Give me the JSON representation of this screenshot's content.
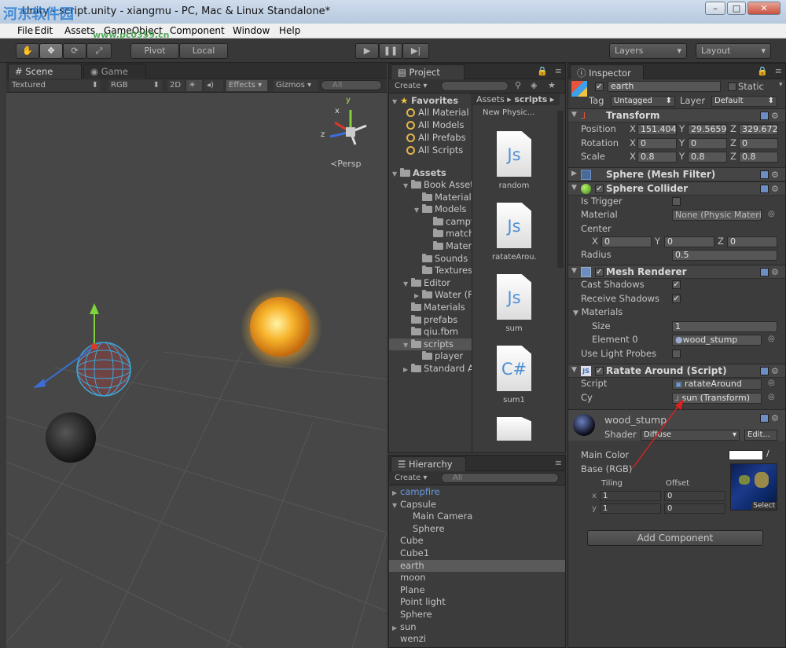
{
  "window": {
    "title": "Unity - script.unity - xiangmu - PC, Mac & Linux Standalone*",
    "watermark": "河东软件园",
    "watermark_url": "www.pc0359.cn"
  },
  "menu": [
    "File",
    "Edit",
    "Assets",
    "GameObject",
    "Component",
    "Window",
    "Help"
  ],
  "toolbar": {
    "pivot": "Pivot",
    "local": "Local",
    "layers": "Layers",
    "layout": "Layout"
  },
  "scene": {
    "tabs": [
      "Scene",
      "Game"
    ],
    "render_mode": "Textured",
    "color_mode": "RGB",
    "mode_2d": "2D",
    "effects": "Effects",
    "gizmos": "Gizmos",
    "search_placeholder": "All",
    "persp": "Persp",
    "axis_y": "y",
    "axis_x": "x",
    "axis_z": "z"
  },
  "project": {
    "tab": "Project",
    "create": "Create",
    "favorites_label": "Favorites",
    "favorites": [
      "All Material",
      "All Models",
      "All Prefabs",
      "All Scripts"
    ],
    "assets_label": "Assets",
    "tree": [
      {
        "label": "Book Asset",
        "indent": 1,
        "open": true
      },
      {
        "label": "Materials",
        "indent": 2,
        "open": false
      },
      {
        "label": "Models",
        "indent": 2,
        "open": true
      },
      {
        "label": "campf",
        "indent": 3,
        "open": false
      },
      {
        "label": "match",
        "indent": 3,
        "open": false
      },
      {
        "label": "Materi",
        "indent": 3,
        "open": false
      },
      {
        "label": "Sounds",
        "indent": 2,
        "open": false
      },
      {
        "label": "Textures",
        "indent": 2,
        "open": false
      },
      {
        "label": "Editor",
        "indent": 1,
        "open": true
      },
      {
        "label": "Water (F",
        "indent": 2,
        "open": false
      },
      {
        "label": "Materials",
        "indent": 1,
        "open": false
      },
      {
        "label": "prefabs",
        "indent": 1,
        "open": false
      },
      {
        "label": "qiu.fbm",
        "indent": 1,
        "open": false
      },
      {
        "label": "scripts",
        "indent": 1,
        "open": true
      },
      {
        "label": "player",
        "indent": 2,
        "open": false
      },
      {
        "label": "Standard A",
        "indent": 1,
        "open": false
      }
    ],
    "breadcrumb": [
      "Assets",
      "scripts"
    ],
    "first_asset": "New Physic...",
    "assets": [
      {
        "label": "random",
        "type": "Js"
      },
      {
        "label": "ratateArou...",
        "type": "Js"
      },
      {
        "label": "sum",
        "type": "Js"
      },
      {
        "label": "sum1",
        "type": "C#"
      }
    ]
  },
  "hierarchy": {
    "tab": "Hierarchy",
    "create": "Create",
    "search_placeholder": "All",
    "items": [
      {
        "label": "campfire",
        "indent": 0,
        "arrow": true,
        "prefab": true
      },
      {
        "label": "Capsule",
        "indent": 0,
        "arrow": true,
        "open": true
      },
      {
        "label": "Main Camera",
        "indent": 1
      },
      {
        "label": "Sphere",
        "indent": 1
      },
      {
        "label": "Cube",
        "indent": 0
      },
      {
        "label": "Cube1",
        "indent": 0
      },
      {
        "label": "earth",
        "indent": 0,
        "selected": true
      },
      {
        "label": "moon",
        "indent": 0
      },
      {
        "label": "Plane",
        "indent": 0
      },
      {
        "label": "Point light",
        "indent": 0
      },
      {
        "label": "Sphere",
        "indent": 0
      },
      {
        "label": "sun",
        "indent": 0,
        "arrow": true
      },
      {
        "label": "wenzi",
        "indent": 0
      }
    ]
  },
  "inspector": {
    "tab": "Inspector",
    "object_name": "earth",
    "static": "Static",
    "tag_label": "Tag",
    "tag": "Untagged",
    "layer_label": "Layer",
    "layer": "Default",
    "transform": {
      "title": "Transform",
      "position_label": "Position",
      "position": [
        "151.404",
        "29.5659",
        "329.672"
      ],
      "rotation_label": "Rotation",
      "rotation": [
        "0",
        "0",
        "0"
      ],
      "scale_label": "Scale",
      "scale": [
        "0.8",
        "0.8",
        "0.8"
      ],
      "x": "X",
      "y": "Y",
      "z": "Z"
    },
    "mesh_filter": "Sphere (Mesh Filter)",
    "collider": {
      "title": "Sphere Collider",
      "is_trigger": "Is Trigger",
      "material_label": "Material",
      "material": "None (Physic Materia",
      "center_label": "Center",
      "center": [
        "0",
        "0",
        "0"
      ],
      "radius_label": "Radius",
      "radius": "0.5"
    },
    "renderer": {
      "title": "Mesh Renderer",
      "cast": "Cast Shadows",
      "receive": "Receive Shadows",
      "materials": "Materials",
      "size_label": "Size",
      "size": "1",
      "element_label": "Element 0",
      "element": "wood_stump",
      "probes": "Use Light Probes"
    },
    "script": {
      "title": "Ratate Around (Script)",
      "script_label": "Script",
      "script": "ratateAround",
      "cy_label": "Cy",
      "cy": "sun (Transform)"
    },
    "material": {
      "name": "wood_stump",
      "shader_label": "Shader",
      "shader": "Diffuse",
      "edit": "Edit...",
      "main_color": "Main Color",
      "base": "Base (RGB)",
      "tiling": "Tiling",
      "offset": "Offset",
      "x": "x",
      "y": "y",
      "tiling_x": "1",
      "offset_x": "0",
      "tiling_y": "1",
      "offset_y": "0",
      "select": "Select"
    },
    "add_component": "Add Component"
  }
}
